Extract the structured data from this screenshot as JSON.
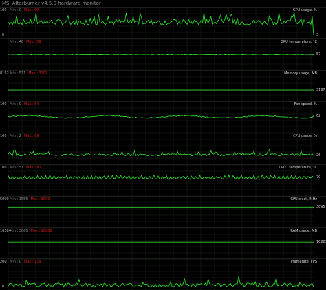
{
  "window": {
    "title": "MSI Afterburner v4.5.0 hardware monitor"
  },
  "colors": {
    "background": "#000000",
    "grid": "#1f2a1f",
    "trace": "#2fd82f",
    "min_text": "#8f8f8f",
    "max_text": "#e01818",
    "label_text": "#d6d6d6"
  },
  "panels": [
    {
      "title": "GPU usage, %",
      "min_text": "Min : 0",
      "max_text": "Max : 99",
      "y_top": "100",
      "y_bottom": "0",
      "current": "3",
      "level": 0.03,
      "baseline": 0.6,
      "style": "spiky",
      "amp": 0.5
    },
    {
      "title": "GPU temperature, °C",
      "min_text": "Min : 46",
      "max_text": "Max : 59",
      "y_top": "",
      "y_bottom": "",
      "current": "57",
      "level": 0.57,
      "baseline": 0.57,
      "style": "flat",
      "amp": 0.03
    },
    {
      "title": "Memory usage, MB",
      "min_text": "Min : 571",
      "max_text": "Max : 3197",
      "y_top": "8192",
      "y_bottom": "",
      "current": "3197",
      "level": 0.39,
      "baseline": 0.39,
      "style": "flat",
      "amp": 0.0
    },
    {
      "title": "Fan speed, %",
      "min_text": "Min : 0",
      "max_text": "Max : 64",
      "y_top": "100",
      "y_bottom": "",
      "current": "62",
      "level": 0.62,
      "baseline": 0.58,
      "style": "wavy",
      "amp": 0.08
    },
    {
      "title": "CPU usage, %",
      "min_text": "Min : 2",
      "max_text": "Max : 69",
      "y_top": "100",
      "y_bottom": "",
      "current": "26",
      "level": 0.26,
      "baseline": 0.3,
      "style": "spiky",
      "amp": 0.2
    },
    {
      "title": "CPU1 temperature, °C",
      "min_text": "Min : 51",
      "max_text": "Max : 87",
      "y_top": "100",
      "y_bottom": "",
      "current": "70",
      "level": 0.7,
      "baseline": 0.68,
      "style": "jagged",
      "amp": 0.08
    },
    {
      "title": "CPU clock, MHz",
      "min_text": "Min : 1556",
      "max_text": "Max : 3900",
      "y_top": "5000",
      "y_bottom": "",
      "current": "3895",
      "level": 0.78,
      "baseline": 0.78,
      "style": "flat",
      "amp": 0.0
    },
    {
      "title": "RAM usage, MB",
      "min_text": "Min : 3066",
      "max_text": "Max : 10806",
      "y_top": "16384",
      "y_bottom": "",
      "current": "10263",
      "level": 0.63,
      "baseline": 0.63,
      "style": "flat",
      "amp": 0.0
    },
    {
      "title": "Framerate, FPS",
      "min_text": "Min : 0",
      "max_text": "Max : 179",
      "y_top": "200",
      "y_bottom": "0",
      "current": "",
      "level": 0.0,
      "baseline": 0.1,
      "style": "spiky",
      "amp": 0.35
    }
  ]
}
